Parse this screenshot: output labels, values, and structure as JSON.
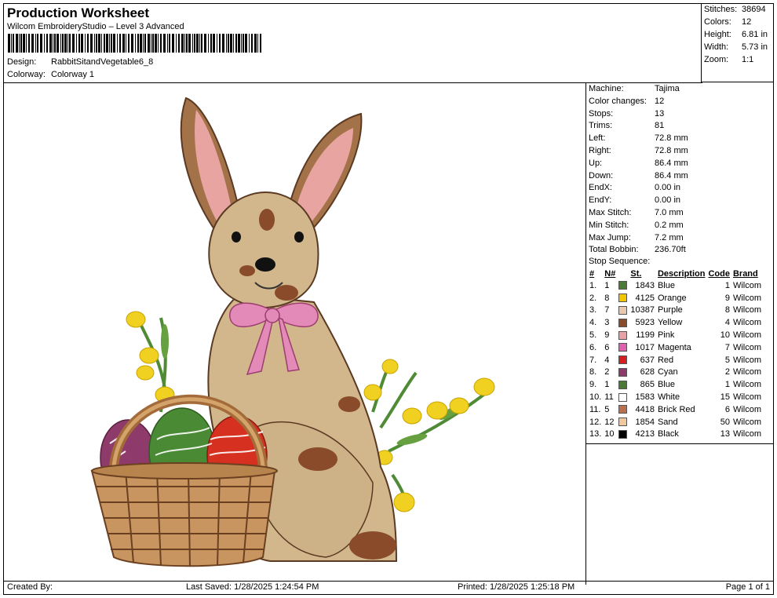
{
  "header": {
    "title": "Production Worksheet",
    "software": "Wilcom EmbroideryStudio – Level 3 Advanced",
    "design_label": "Design:",
    "design_value": "RabbitSitandVegetable6_8",
    "colorway_label": "Colorway:",
    "colorway_value": "Colorway 1"
  },
  "summary": [
    {
      "label": "Stitches:",
      "value": "38694"
    },
    {
      "label": "Colors:",
      "value": "12"
    },
    {
      "label": "Height:",
      "value": "6.81 in"
    },
    {
      "label": "Width:",
      "value": "5.73 in"
    },
    {
      "label": "Zoom:",
      "value": "1:1"
    }
  ],
  "info": [
    {
      "label": "Machine:",
      "value": "Tajima"
    },
    {
      "label": "Color changes:",
      "value": "12"
    },
    {
      "label": "Stops:",
      "value": "13"
    },
    {
      "label": "Trims:",
      "value": "81"
    },
    {
      "label": "Left:",
      "value": "72.8 mm"
    },
    {
      "label": "Right:",
      "value": "72.8 mm"
    },
    {
      "label": "Up:",
      "value": "86.4 mm"
    },
    {
      "label": "Down:",
      "value": "86.4 mm"
    },
    {
      "label": "EndX:",
      "value": "0.00 in"
    },
    {
      "label": "EndY:",
      "value": "0.00 in"
    },
    {
      "label": "Max Stitch:",
      "value": "7.0 mm"
    },
    {
      "label": "Min Stitch:",
      "value": "0.2 mm"
    },
    {
      "label": "Max Jump:",
      "value": "7.2 mm"
    },
    {
      "label": "Total Bobbin:",
      "value": "236.70ft"
    }
  ],
  "stop_sequence_label": "Stop Sequence:",
  "stop_columns": [
    "#",
    "N#",
    "",
    "St.",
    "Description",
    "Code",
    "Brand"
  ],
  "stops": [
    {
      "n": "1.",
      "nn": "1",
      "color": "#4a7a35",
      "st": "1843",
      "desc": "Blue",
      "code": "1",
      "brand": "Wilcom"
    },
    {
      "n": "2.",
      "nn": "8",
      "color": "#f2c500",
      "st": "4125",
      "desc": "Orange",
      "code": "9",
      "brand": "Wilcom"
    },
    {
      "n": "3.",
      "nn": "7",
      "color": "#e8c9b0",
      "st": "10387",
      "desc": "Purple",
      "code": "8",
      "brand": "Wilcom"
    },
    {
      "n": "4.",
      "nn": "3",
      "color": "#8a4b2a",
      "st": "5923",
      "desc": "Yellow",
      "code": "4",
      "brand": "Wilcom"
    },
    {
      "n": "5.",
      "nn": "9",
      "color": "#e8a0a8",
      "st": "1199",
      "desc": "Pink",
      "code": "10",
      "brand": "Wilcom"
    },
    {
      "n": "6.",
      "nn": "6",
      "color": "#e060b0",
      "st": "1017",
      "desc": "Magenta",
      "code": "7",
      "brand": "Wilcom"
    },
    {
      "n": "7.",
      "nn": "4",
      "color": "#d42020",
      "st": "637",
      "desc": "Red",
      "code": "5",
      "brand": "Wilcom"
    },
    {
      "n": "8.",
      "nn": "2",
      "color": "#8e3a6a",
      "st": "628",
      "desc": "Cyan",
      "code": "2",
      "brand": "Wilcom"
    },
    {
      "n": "9.",
      "nn": "1",
      "color": "#4a7a35",
      "st": "865",
      "desc": "Blue",
      "code": "1",
      "brand": "Wilcom"
    },
    {
      "n": "10.",
      "nn": "11",
      "color": "#ffffff",
      "st": "1583",
      "desc": "White",
      "code": "15",
      "brand": "Wilcom"
    },
    {
      "n": "11.",
      "nn": "5",
      "color": "#b87050",
      "st": "4418",
      "desc": "Brick Red",
      "code": "6",
      "brand": "Wilcom"
    },
    {
      "n": "12.",
      "nn": "12",
      "color": "#f0c8a0",
      "st": "1854",
      "desc": "Sand",
      "code": "50",
      "brand": "Wilcom"
    },
    {
      "n": "13.",
      "nn": "10",
      "color": "#000000",
      "st": "4213",
      "desc": "Black",
      "code": "13",
      "brand": "Wilcom"
    }
  ],
  "footer": {
    "created": "Created By:",
    "saved": "Last Saved: 1/28/2025 1:24:54 PM",
    "printed": "Printed: 1/28/2025 1:25:18 PM",
    "page": "Page 1 of 1"
  }
}
